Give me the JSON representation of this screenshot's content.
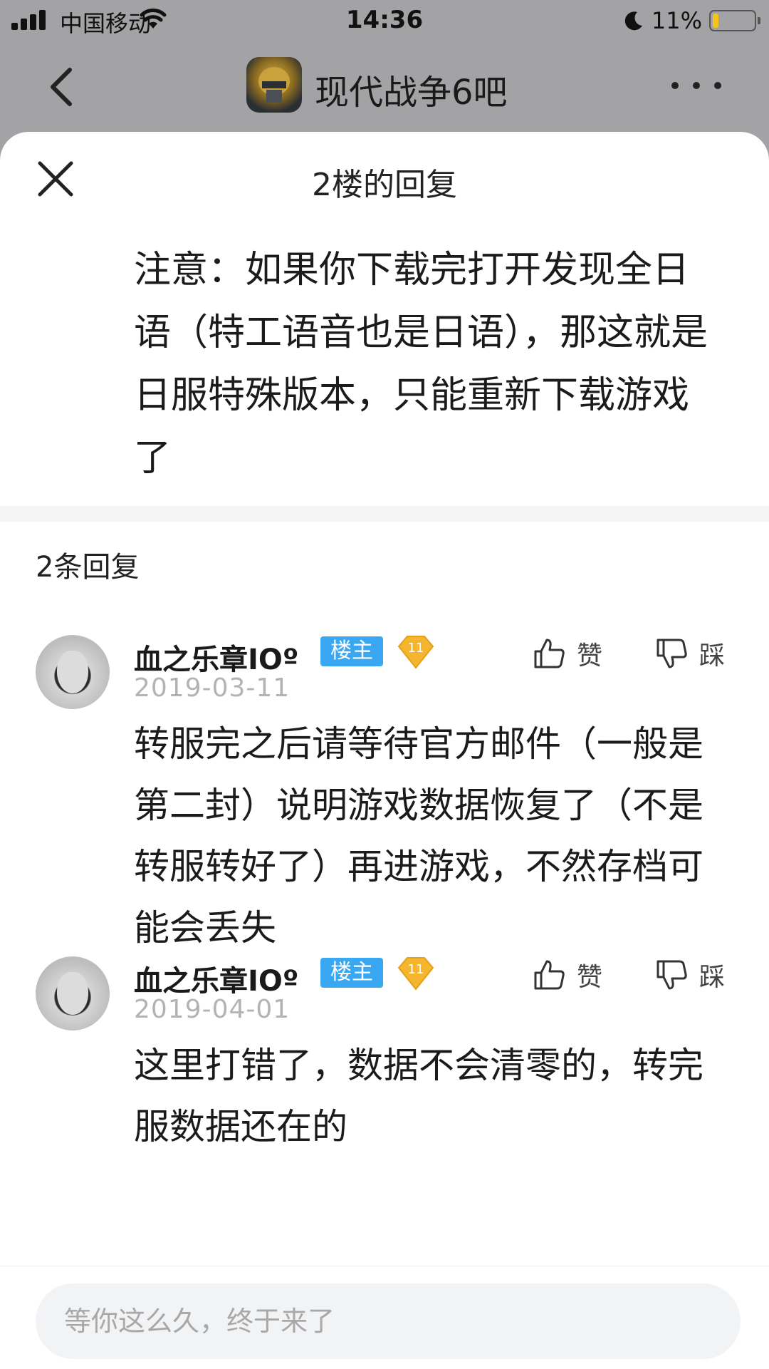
{
  "status_bar": {
    "carrier": "中国移动",
    "time": "14:36",
    "battery": "11%",
    "battery_level": 0.11,
    "icons": [
      "signal-icon",
      "wifi-icon",
      "moon-icon",
      "battery-icon"
    ]
  },
  "nav": {
    "title": "现代战争6吧"
  },
  "sheet": {
    "title": "2楼的回复",
    "main_text": "注意：如果你下载完打开发现全日语（特工语音也是日语），那这就是日服特殊版本，只能重新下载游戏了",
    "reply_count": "2条回复"
  },
  "replies": [
    {
      "user": "血之乐章IOº",
      "badge": "楼主",
      "level": "11",
      "date": "2019-03-11",
      "like_label": "赞",
      "dislike_label": "踩",
      "text": "转服完之后请等待官方邮件（一般是第二封）说明游戏数据恢复了（不是转服转好了）再进游戏，不然存档可能会丢失"
    },
    {
      "user": "血之乐章IOº",
      "badge": "楼主",
      "level": "11",
      "date": "2019-04-01",
      "like_label": "赞",
      "dislike_label": "踩",
      "text": "这里打错了，数据不会清零的，转完服数据还在的"
    }
  ],
  "input": {
    "placeholder": "等你这么久，终于来了"
  },
  "colors": {
    "badge_blue": "#39a7f2",
    "level_gold": "#f5b52e",
    "backdrop": "#a3a3a5"
  }
}
